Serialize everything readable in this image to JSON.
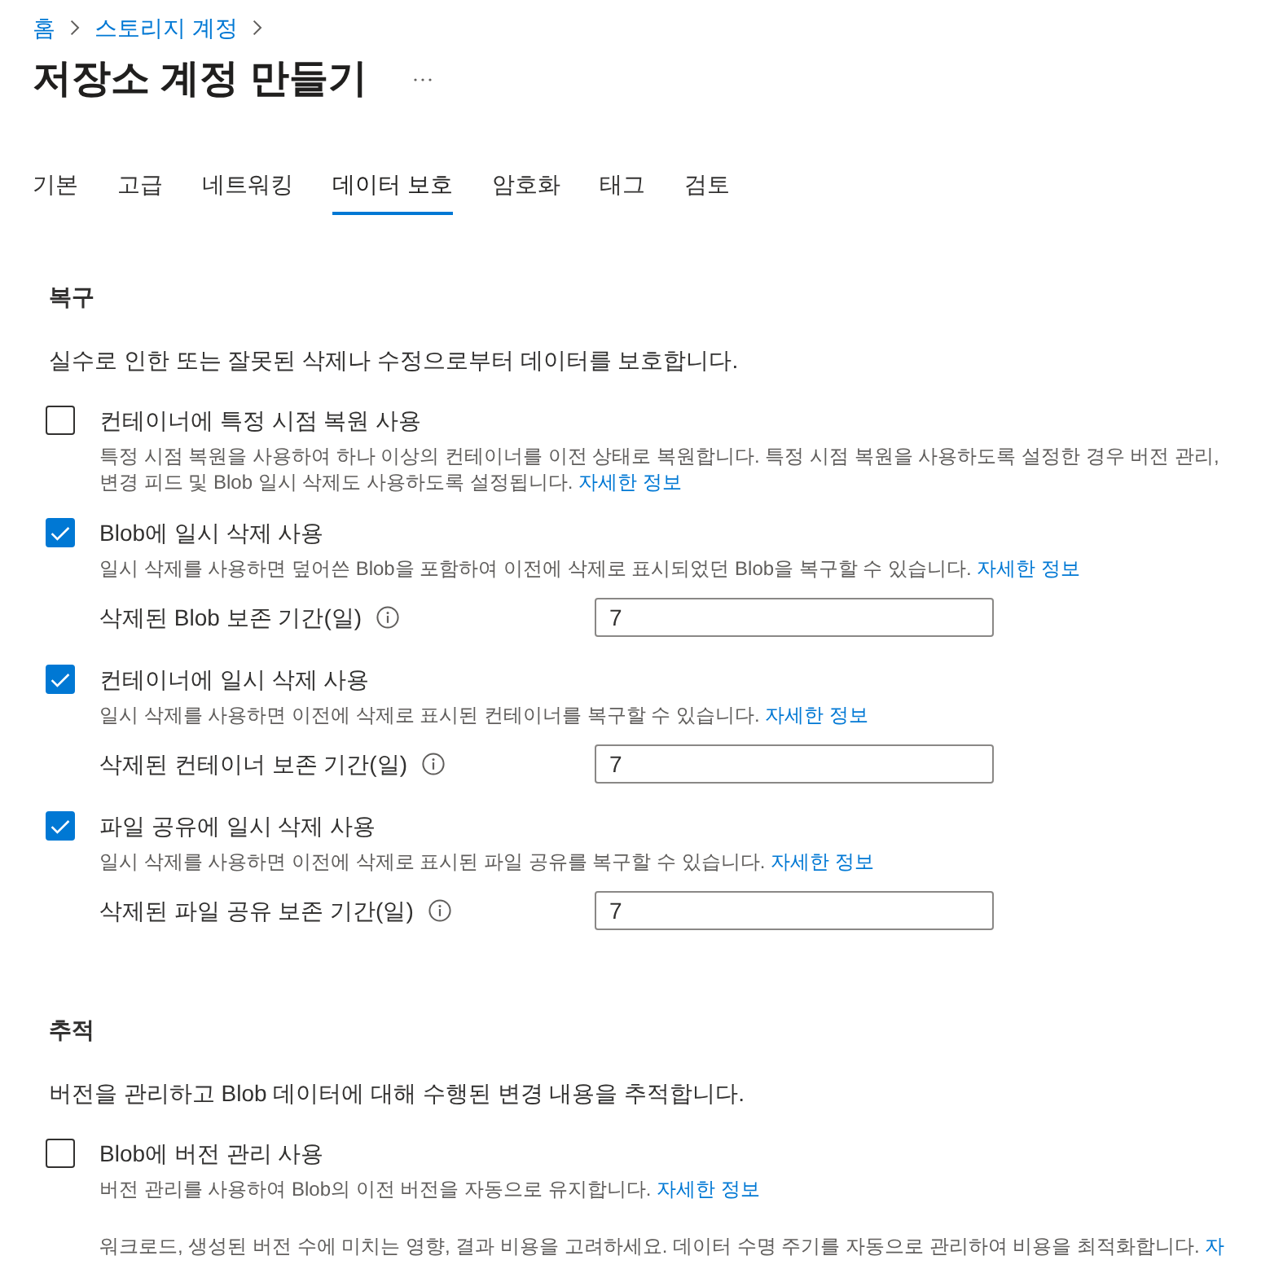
{
  "breadcrumb": [
    {
      "label": "홈"
    },
    {
      "label": "스토리지 계정"
    }
  ],
  "title": "저장소 계정 만들기",
  "tabs": [
    {
      "label": "기본",
      "selected": false
    },
    {
      "label": "고급",
      "selected": false
    },
    {
      "label": "네트워킹",
      "selected": false
    },
    {
      "label": "데이터 보호",
      "selected": true
    },
    {
      "label": "암호화",
      "selected": false
    },
    {
      "label": "태그",
      "selected": false
    },
    {
      "label": "검토",
      "selected": false
    }
  ],
  "sections": [
    {
      "heading": "복구",
      "description": "실수로 인한 또는 잘못된 삭제나 수정으로부터 데이터를 보호합니다.",
      "options": [
        {
          "label": "컨테이너에 특정 시점 복원 사용",
          "checked": false,
          "description": "특정 시점 복원을 사용하여 하나 이상의 컨테이너를 이전 상태로 복원합니다. 특정 시점 복원을 사용하도록 설정한 경우 버전 관리, 변경 피드 및 Blob 일시 삭제도 사용하도록 설정됩니다.",
          "link": "자세한 정보"
        },
        {
          "label": "Blob에 일시 삭제 사용",
          "checked": true,
          "description": "일시 삭제를 사용하면 덮어쓴 Blob을 포함하여 이전에 삭제로 표시되었던 Blob을 복구할 수 있습니다.",
          "link": "자세한 정보",
          "retention": {
            "label": "삭제된 Blob 보존 기간(일)",
            "value": "7"
          }
        },
        {
          "label": "컨테이너에 일시 삭제 사용",
          "checked": true,
          "description": "일시 삭제를 사용하면 이전에 삭제로 표시된 컨테이너를 복구할 수 있습니다.",
          "link": "자세한 정보",
          "retention": {
            "label": "삭제된 컨테이너 보존 기간(일)",
            "value": "7"
          }
        },
        {
          "label": "파일 공유에 일시 삭제 사용",
          "checked": true,
          "description": "일시 삭제를 사용하면 이전에 삭제로 표시된 파일 공유를 복구할 수 있습니다.",
          "link": "자세한 정보",
          "retention": {
            "label": "삭제된 파일 공유 보존 기간(일)",
            "value": "7"
          }
        }
      ]
    },
    {
      "heading": "추적",
      "description": "버전을 관리하고 Blob 데이터에 대해 수행된 변경 내용을 추적합니다.",
      "options": [
        {
          "label": "Blob에 버전 관리 사용",
          "checked": false,
          "description": "버전 관리를 사용하여 Blob의 이전 버전을 자동으로 유지합니다.",
          "link": "자세한 정보",
          "note": "워크로드, 생성된 버전 수에 미치는 영향, 결과 비용을 고려하세요. 데이터 수명 주기를 자동으로 관리하여 비용을 최적화합니다.",
          "note_link": "자"
        }
      ]
    }
  ]
}
